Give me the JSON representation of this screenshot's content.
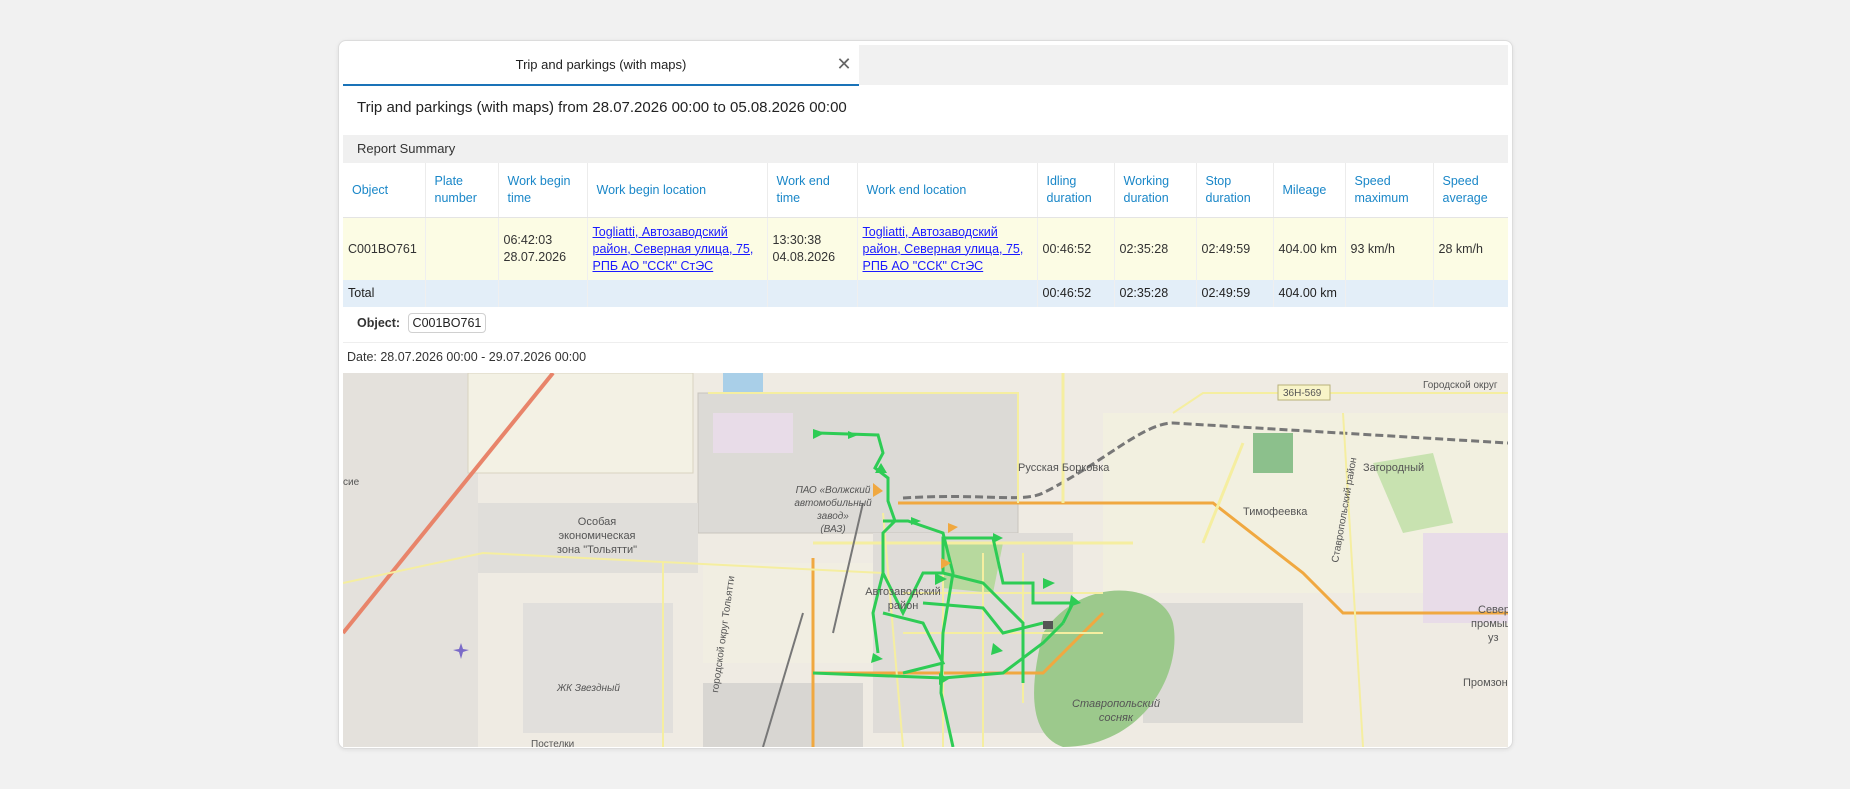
{
  "tab": {
    "label": "Trip and parkings (with maps)",
    "close": "✕"
  },
  "report_title": "Trip and parkings (with maps) from 28.07.2026 00:00 to 05.08.2026 00:00",
  "summary_title": "Report Summary",
  "columns": {
    "object": "Object",
    "plate": "Plate number",
    "begin_time": "Work begin time",
    "begin_loc": "Work begin location",
    "end_time": "Work end time",
    "end_loc": "Work end location",
    "idling": "Idling duration",
    "working": "Working duration",
    "stop": "Stop duration",
    "mileage": "Mileage",
    "speed_max": "Speed maximum",
    "speed_avg": "Speed average"
  },
  "row": {
    "object": "C001BO761",
    "plate": "",
    "begin_time": "06:42:03 28.07.2026",
    "begin_loc": "Togliatti, Автозаводский район, Северная улица, 75, РПБ АО \"ССК\" СтЭС",
    "end_time": "13:30:38 04.08.2026",
    "end_loc": "Togliatti, Автозаводский район, Северная улица, 75, РПБ АО \"ССК\" СтЭС",
    "idling": "00:46:52",
    "working": "02:35:28",
    "stop": "02:49:59",
    "mileage": "404.00 km",
    "speed_max": "93 km/h",
    "speed_avg": "28 km/h"
  },
  "total": {
    "label": "Total",
    "idling": "00:46:52",
    "working": "02:35:28",
    "stop": "02:49:59",
    "mileage": "404.00 km"
  },
  "object_filter": {
    "label": "Object:",
    "value": "C001BO761"
  },
  "date_range": "Date: 28.07.2026 00:00 - 29.07.2026 00:00",
  "map": {
    "labels": {
      "road_sign": "36Н-569",
      "ring_road": "Городской округ",
      "russkaya_borkovka": "Русская Борковка",
      "zagorodny": "Загородный",
      "timofeevka": "Тимофеевка",
      "vaz_1": "ПАО «Волжский",
      "vaz_2": "автомобильный",
      "vaz_3": "завод»",
      "vaz_4": "(ВАЗ)",
      "sez_1": "Особая",
      "sez_2": "экономическая",
      "sez_3": "зона \"Тольятти\"",
      "avtozavodsky_1": "Автозаводский",
      "avtozavodsky_2": "район",
      "stavropol_pine_1": "Ставропольский",
      "stavropol_pine_2": "сосняк",
      "stavropol_district": "Ставропольский район",
      "zvezdny": "ЖК Звездный",
      "tolyatti_district": "городской округ Тольятти",
      "north_1": "Север",
      "north_2": "промыш",
      "north_3": "уз",
      "promzona": "Промзон",
      "postelki": "Постелки",
      "left_edge": "сие"
    },
    "colors": {
      "track": "#2ecc55",
      "major_road": "#f0a840",
      "minor_road": "#f5eea0"
    }
  }
}
